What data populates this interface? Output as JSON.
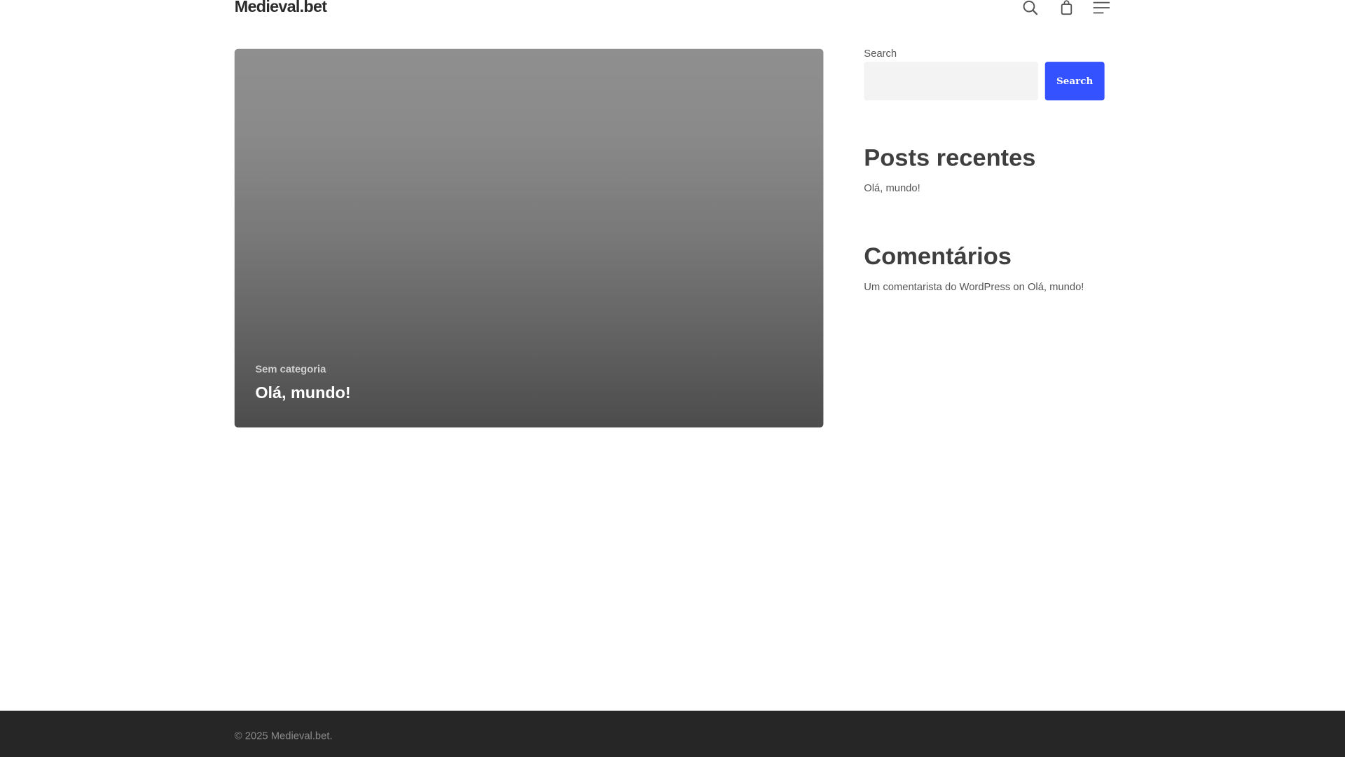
{
  "header": {
    "site_title": "Medieval.bet",
    "icons": [
      "search-icon",
      "shopping-bag-icon",
      "menu-icon"
    ]
  },
  "post": {
    "category": "Sem categoria",
    "title": "Olá, mundo!"
  },
  "sidebar": {
    "search": {
      "label": "Search",
      "value": "",
      "placeholder": "",
      "button_label": "Search"
    },
    "recent_posts": {
      "title": "Posts recentes",
      "items": [
        {
          "label": "Olá, mundo!"
        }
      ]
    },
    "comments": {
      "title": "Comentários",
      "items": [
        {
          "author": "Um comentarista do WordPress",
          "connector": " on ",
          "post": "Olá, mundo!"
        }
      ]
    }
  },
  "footer": {
    "copyright": "© 2025 Medieval.bet."
  },
  "colors": {
    "accent": "#3452ff",
    "footer_bg": "#262626",
    "text": "#555555",
    "heading": "#3f3f3f"
  }
}
